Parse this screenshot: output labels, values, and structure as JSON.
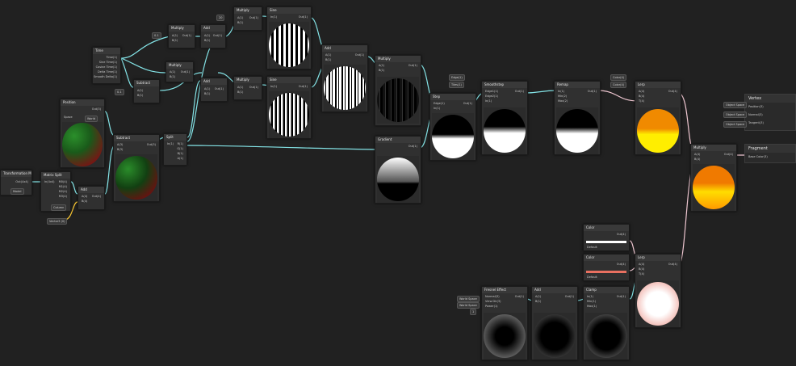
{
  "colors": {
    "bg": "#212121",
    "node": "#303030",
    "header": "#393939",
    "wire_vec": "#84e4e7",
    "wire_col": "#f0c8d2",
    "accent": "#ffcc33"
  },
  "nodes": {
    "time": {
      "title": "Time",
      "outs": [
        "Time(1)",
        "Sine Time(1)",
        "Cosine Time(1)",
        "Delta Time(1)",
        "Smooth Delta(1)"
      ]
    },
    "multiply_a": {
      "title": "Multiply",
      "in_a": "A(1)",
      "in_b": "B(1)",
      "out": "Out(1)",
      "val": "0.1"
    },
    "multiply_b": {
      "title": "Multiply",
      "in_a": "A(1)",
      "in_b": "B(1)",
      "out": "Out(1)"
    },
    "add_a": {
      "title": "Add",
      "in_a": "A(1)",
      "in_b": "B(1)",
      "out": "Out(1)"
    },
    "multiply_top": {
      "title": "Multiply",
      "in_a": "A(1)",
      "in_b": "B(1)",
      "out": "Out(1)",
      "val": "20"
    },
    "sine_top": {
      "title": "Sine",
      "in": "In(1)",
      "out": "Out(1)"
    },
    "subtract_a": {
      "title": "Subtract",
      "in_a": "A(1)",
      "in_b": "B(1)",
      "out": "Out(1)"
    },
    "add_b": {
      "title": "Add",
      "in_a": "A(1)",
      "in_b": "B(1)",
      "out": "Out(1)"
    },
    "multiply_mid": {
      "title": "Multiply",
      "in_a": "A(1)",
      "in_b": "B(1)",
      "out": "Out(1)",
      "val": "30"
    },
    "sine_mid": {
      "title": "Sine",
      "in": "In(1)",
      "out": "Out(1)"
    },
    "add_c": {
      "title": "Add",
      "in_a": "A(1)",
      "in_b": "B(1)",
      "out": "Out(1)"
    },
    "multiply_c": {
      "title": "Multiply",
      "in_a": "A(1)",
      "in_b": "B(1)",
      "out": "Out(1)"
    },
    "position": {
      "title": "Position",
      "out": "Out(3)",
      "space_label": "Space",
      "space_value": "World"
    },
    "subtract_b": {
      "title": "Subtract",
      "in_a": "A(3)",
      "in_b": "B(3)",
      "out": "Out(3)"
    },
    "split": {
      "title": "Split",
      "in": "In(1)",
      "outs": [
        "R(1)",
        "G(1)",
        "B(1)",
        "A(1)"
      ]
    },
    "object": {
      "title": "Transformation Matrix",
      "out": "Out(4x4)",
      "dropdown": "Model"
    },
    "matrix_split": {
      "title": "Matrix Split",
      "in": "In(4x4)",
      "outs": [
        "M0(4)",
        "M1(4)",
        "M2(4)",
        "M3(4)"
      ],
      "dropdown": "Column"
    },
    "add_d": {
      "title": "Add",
      "in_a": "A(4)",
      "in_b": "B(4)",
      "out": "Out(4)"
    },
    "vector_chip": "Vector3 (0)",
    "gradient": {
      "title": "Gradient",
      "in": "In(1)",
      "out": "Out(1)"
    },
    "step": {
      "title": "Step",
      "in_a": "Edge(1)",
      "in_b": "In(1)",
      "out": "Out(1)"
    },
    "smoothstep": {
      "title": "Smoothstep",
      "ins": [
        "Edge1(1)",
        "Edge2(1)",
        "In(1)"
      ],
      "out": "Out(1)"
    },
    "remap": {
      "title": "Remap",
      "ins": [
        "In(1)",
        "Min(2)",
        "Max(2)"
      ],
      "out": "Out(1)"
    },
    "lerp_a": {
      "title": "Lerp",
      "ins": [
        "A(4)",
        "B(4)",
        "T(4)"
      ],
      "out": "Out(4)"
    },
    "multiply_out": {
      "title": "Multiply",
      "in_a": "A(4)",
      "in_b": "B(4)",
      "out": "Out(4)"
    },
    "color_a": {
      "title": "Color",
      "out": "Out(4)",
      "mode": "Default"
    },
    "color_b": {
      "title": "Color",
      "out": "Out(4)",
      "mode": "Default"
    },
    "lerp_b": {
      "title": "Lerp",
      "ins": [
        "A(4)",
        "B(4)",
        "T(4)"
      ],
      "out": "Out(4)"
    },
    "fresnel": {
      "title": "Fresnel Effect",
      "ins": [
        "Normal(3)",
        "View Dir(3)",
        "Power(1)"
      ],
      "out": "Out(1)"
    },
    "add_e": {
      "title": "Add",
      "in_a": "A(1)",
      "in_b": "B(1)",
      "out": "Out(1)"
    },
    "clamp": {
      "title": "Clamp",
      "ins": [
        "In(1)",
        "Min(1)",
        "Max(1)"
      ],
      "out": "Out(1)"
    },
    "chips_edge": [
      "Edge(1)",
      "Tiles(1)"
    ],
    "chips_col": [
      "Color(4)",
      "Color(4)"
    ],
    "chips_fresnel": [
      "World Space",
      "World Space",
      "1"
    ],
    "chip_x": "X 0.5",
    "chip_vector": "Vector(1)"
  },
  "vertex": {
    "title": "Vertex",
    "fields": [
      "Position(3)",
      "Normal(3)",
      "Tangent(3)"
    ],
    "labels": [
      "Object Space",
      "Object Space",
      "Object Space"
    ]
  },
  "fragment": {
    "title": "Fragment",
    "fields": [
      "Base Color(3)"
    ]
  }
}
